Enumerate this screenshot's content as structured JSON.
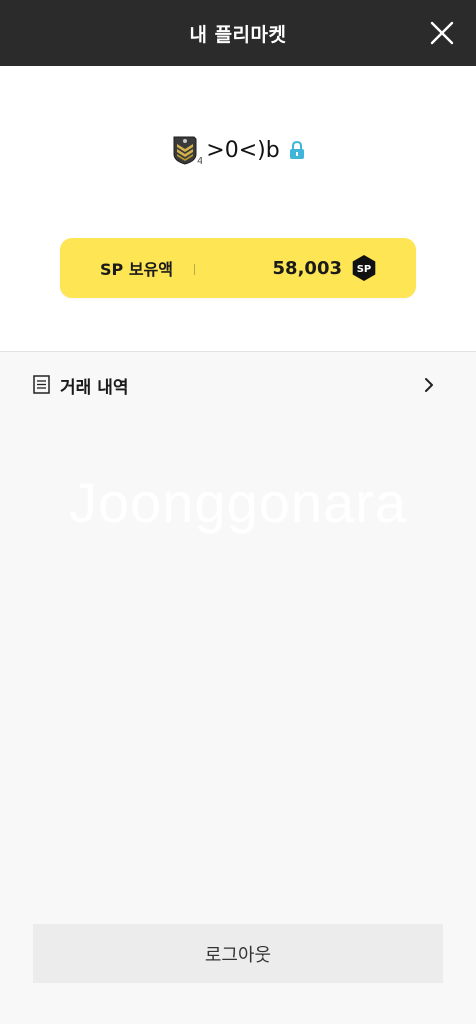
{
  "header": {
    "title": "내 플리마켓",
    "close_icon": "close-icon"
  },
  "profile": {
    "badge_icon": "rank-badge-icon",
    "badge_level": "4",
    "nickname": ">0<)b",
    "lock_icon": "lock-icon"
  },
  "sp": {
    "label": "SP 보유액",
    "amount": "58,003",
    "coin_text": "SP",
    "coin_icon": "sp-coin-icon",
    "card_color": "#fde553"
  },
  "menu": {
    "items": [
      {
        "label": "거래 내역",
        "icon": "document-icon",
        "chevron": "chevron-right-icon"
      }
    ]
  },
  "watermark": "Joonggonara",
  "footer": {
    "logout_label": "로그아웃"
  },
  "colors": {
    "header_bg": "#2b2b2b",
    "accent_lock": "#3fb6d9",
    "page_bg": "#f8f8f8"
  }
}
